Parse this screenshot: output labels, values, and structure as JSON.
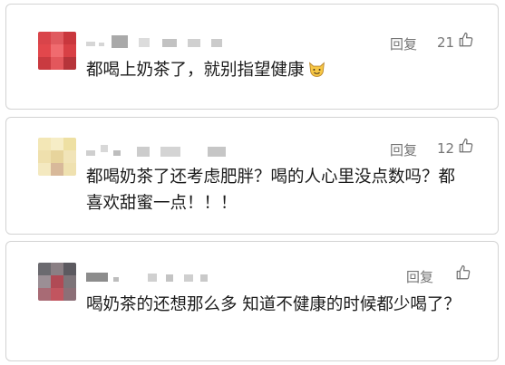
{
  "comments": [
    {
      "reply_label": "回复",
      "likes": "21",
      "text": "都喝上奶茶了，就别指望健康"
    },
    {
      "reply_label": "回复",
      "likes": "12",
      "text": "都喝奶茶了还考虑肥胖？喝的人心里没点数吗？都喜欢甜蜜一点！！！"
    },
    {
      "reply_label": "回复",
      "likes": "",
      "text": "喝奶茶的还想那么多 知道不健康的时候都少喝了？"
    }
  ],
  "icons": {
    "like": "thumbs-up-outline-icon",
    "emoji": "smiling-cat-emoji"
  },
  "colors": {
    "card_border": "#d3d3d3",
    "secondary_text": "#757575",
    "body_text": "#1b1b1b"
  }
}
